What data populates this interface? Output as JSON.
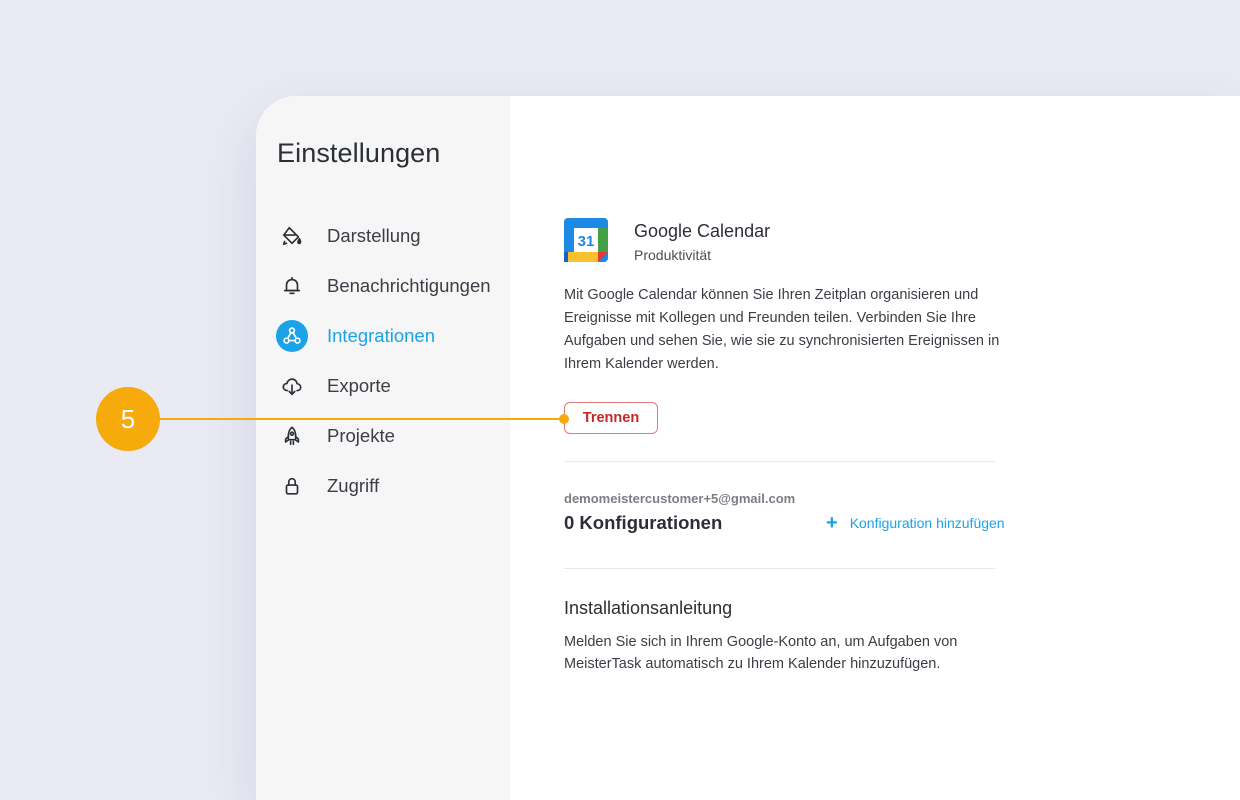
{
  "sidebar": {
    "title": "Einstellungen",
    "items": [
      {
        "label": "Darstellung",
        "icon": "paint-bucket-icon",
        "active": false
      },
      {
        "label": "Benachrichtigungen",
        "icon": "bell-icon",
        "active": false
      },
      {
        "label": "Integrationen",
        "icon": "integrations-icon",
        "active": true
      },
      {
        "label": "Exporte",
        "icon": "cloud-download-icon",
        "active": false
      },
      {
        "label": "Projekte",
        "icon": "rocket-icon",
        "active": false
      },
      {
        "label": "Zugriff",
        "icon": "lock-icon",
        "active": false
      }
    ]
  },
  "integration": {
    "name": "Google Calendar",
    "category": "Produktivität",
    "logo_text": "31",
    "description": "Mit Google Calendar können Sie Ihren Zeitplan organisieren und Ereignisse mit Kollegen und Freunden teilen. Verbinden Sie Ihre Aufgaben und sehen Sie, wie sie zu synchronisierten Ereignissen in Ihrem Kalender werden.",
    "disconnect_label": "Trennen",
    "account_email": "demomeistercustomer+5@gmail.com",
    "config_count": "0 Konfigurationen",
    "add_config_label": "Konfiguration hinzufügen",
    "guide_title": "Installationsanleitung",
    "guide_text": "Melden Sie sich in Ihrem Google-Konto an, um Aufgaben von MeisterTask automatisch zu Ihrem Kalender hinzuzufügen."
  },
  "callout": {
    "number": "5"
  },
  "colors": {
    "accent": "#1aa3e8",
    "danger": "#c62828",
    "callout": "#f7aa0c"
  }
}
